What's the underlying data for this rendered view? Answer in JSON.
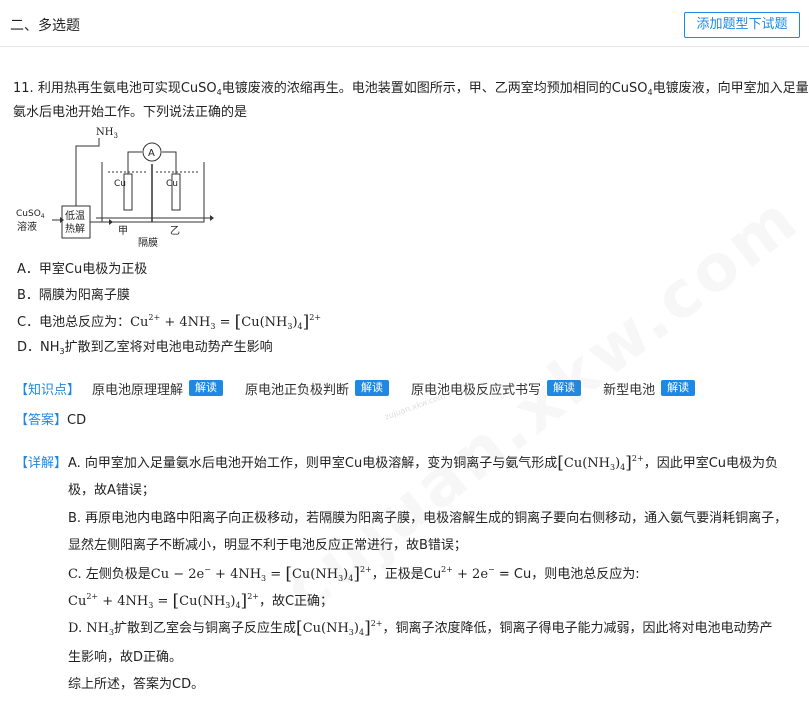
{
  "section": {
    "title": "二、多选题"
  },
  "toolbar": {
    "add_label": "添加题型下试题"
  },
  "question": {
    "number": "11.",
    "line1": "利用热再生氨电池可实现CuSO",
    "line1_sub": "4",
    "line1_b": "电镀废液的浓缩再生。电池装置如图所示，甲、乙两室均预加相同的CuSO",
    "line1_sub2": "4",
    "line1_c": "电镀废液，向甲室加入足量",
    "line2": "氨水后电池开始工作。下列说法正确的是"
  },
  "diagram": {
    "nh3": "NH",
    "nh3_sub": "3",
    "ammeter": "A",
    "cu_left": "Cu",
    "cu_right": "Cu",
    "cuso4_line1": "CuSO",
    "cuso4_sub": "4",
    "cuso4_line2": "溶液",
    "box_line1": "低温",
    "box_line2": "热解",
    "jia": "甲",
    "yi": "乙",
    "membrane": "隔膜"
  },
  "options": {
    "a": "A．甲室Cu电极为正极",
    "b": "B．隔膜为阳离子膜",
    "c_prefix": "C．电池总反应为：",
    "c_eq_1": "Cu",
    "c_eq_sup": "2+",
    "c_eq_2": " + 4NH",
    "c_eq_sub": "3",
    "c_eq_3": " = ",
    "c_complex_a": "Cu(NH",
    "c_complex_sub1": "3",
    "c_complex_b": ")",
    "c_complex_sub2": "4",
    "c_complex_sup": "2+",
    "d_prefix": "D．NH",
    "d_sub": "3",
    "d_text": "扩散到乙室将对电池电动势产生影响"
  },
  "knowledge": {
    "tag": "【知识点】",
    "points": [
      "原电池原理理解",
      "原电池正负极判断",
      "原电池电极反应式书写",
      "新型电池"
    ],
    "button": "解读"
  },
  "answer": {
    "tag": "【答案】",
    "value": "CD"
  },
  "detail": {
    "tag": "【详解】",
    "a1": "A. 向甲室加入足量氨水后电池开始工作，则甲室Cu电极溶解，变为铜离子与氨气形成",
    "a1_end": "，因此甲室Cu电极为负",
    "a2": "极，故A错误；",
    "b1": "B. 再原电池内电路中阳离子向正极移动，若隔膜为阳离子膜，电极溶解生成的铜离子要向右侧移动，通入氨气要消耗铜离子，",
    "b2": "显然左侧阳离子不断减小，明显不利于电池反应正常进行，故B错误；",
    "c1_a": "C. 左侧负极是Cu − 2e",
    "c1_sup": "−",
    "c1_b": " + 4NH",
    "c1_c": " = ",
    "c1_d": "，正极是Cu",
    "c1_e": " + 2e",
    "c1_f": " = Cu，则电池总反应为:",
    "c2_a": "Cu",
    "c2_b": " + 4NH",
    "c2_c": " = ",
    "c2_d": "，故C正确；",
    "d1_a": "D. NH",
    "d1_b": "扩散到乙室会与铜离子反应生成",
    "d1_c": "，铜离子浓度降低，铜离子得电子能力减弱，因此将对电池电动势产",
    "d2": "生影响，故D正确。",
    "conclusion": "综上所述，答案为CD。"
  },
  "watermark": {
    "text": "cujuan.xkw.com",
    "small": "zujuan.xkw.com"
  }
}
